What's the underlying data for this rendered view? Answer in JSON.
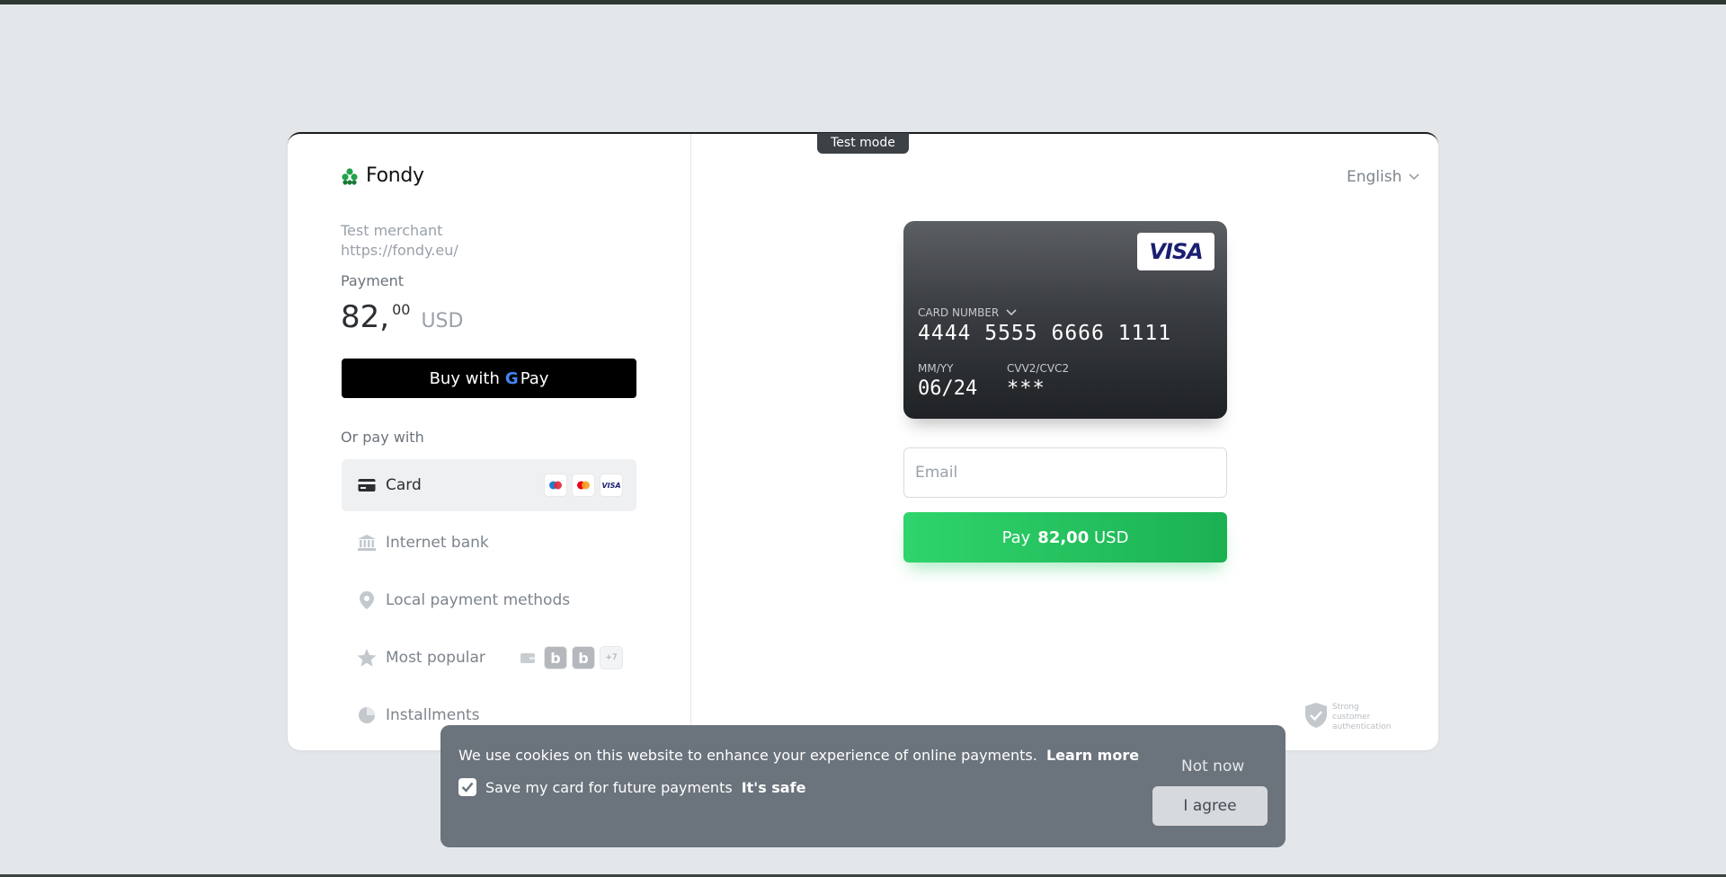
{
  "test_mode_label": "Test mode",
  "brand": {
    "name": "Fondy",
    "color": "#22a24a"
  },
  "merchant": {
    "name": "Test merchant",
    "url": "https://fondy.eu/"
  },
  "payment": {
    "label": "Payment",
    "amount_int": "82,",
    "amount_dec": "00",
    "currency": "USD"
  },
  "gpay": {
    "prefix": "Buy with",
    "g": "G",
    "suffix": "Pay"
  },
  "or_pay_with": "Or pay with",
  "methods": [
    {
      "label": "Card",
      "icon": "card-icon",
      "badges": [
        "maestro",
        "mastercard",
        "VISA"
      ]
    },
    {
      "label": "Internet bank",
      "icon": "bank-icon"
    },
    {
      "label": "Local payment methods",
      "icon": "location-icon"
    },
    {
      "label": "Most popular",
      "icon": "star-icon",
      "badges": [
        "wallet",
        "b",
        "b",
        "+7"
      ]
    },
    {
      "label": "Installments",
      "icon": "pie-chart-icon"
    }
  ],
  "language": "English",
  "card": {
    "brand": "VISA",
    "number_label": "CARD NUMBER",
    "number": "4444 5555 6666 1111",
    "exp_label": "MM/YY",
    "exp": "06/24",
    "cvv_label": "CVV2/CVC2",
    "cvv": "***"
  },
  "email_placeholder": "Email",
  "pay_button": {
    "label": "Pay",
    "amount": "82,00",
    "currency": "USD"
  },
  "sca_text": "Strong customer authentication",
  "cookie": {
    "text": "We use cookies on this website to enhance your experience of online payments.",
    "learn_more": "Learn more",
    "save_card": "Save my card for future payments",
    "its_safe": "It's safe",
    "not_now": "Not now",
    "agree": "I agree"
  },
  "colors": {
    "pay_green": "#1bb152",
    "page_bg": "#e4e7ea",
    "cookie_bg": "#6b737c"
  }
}
